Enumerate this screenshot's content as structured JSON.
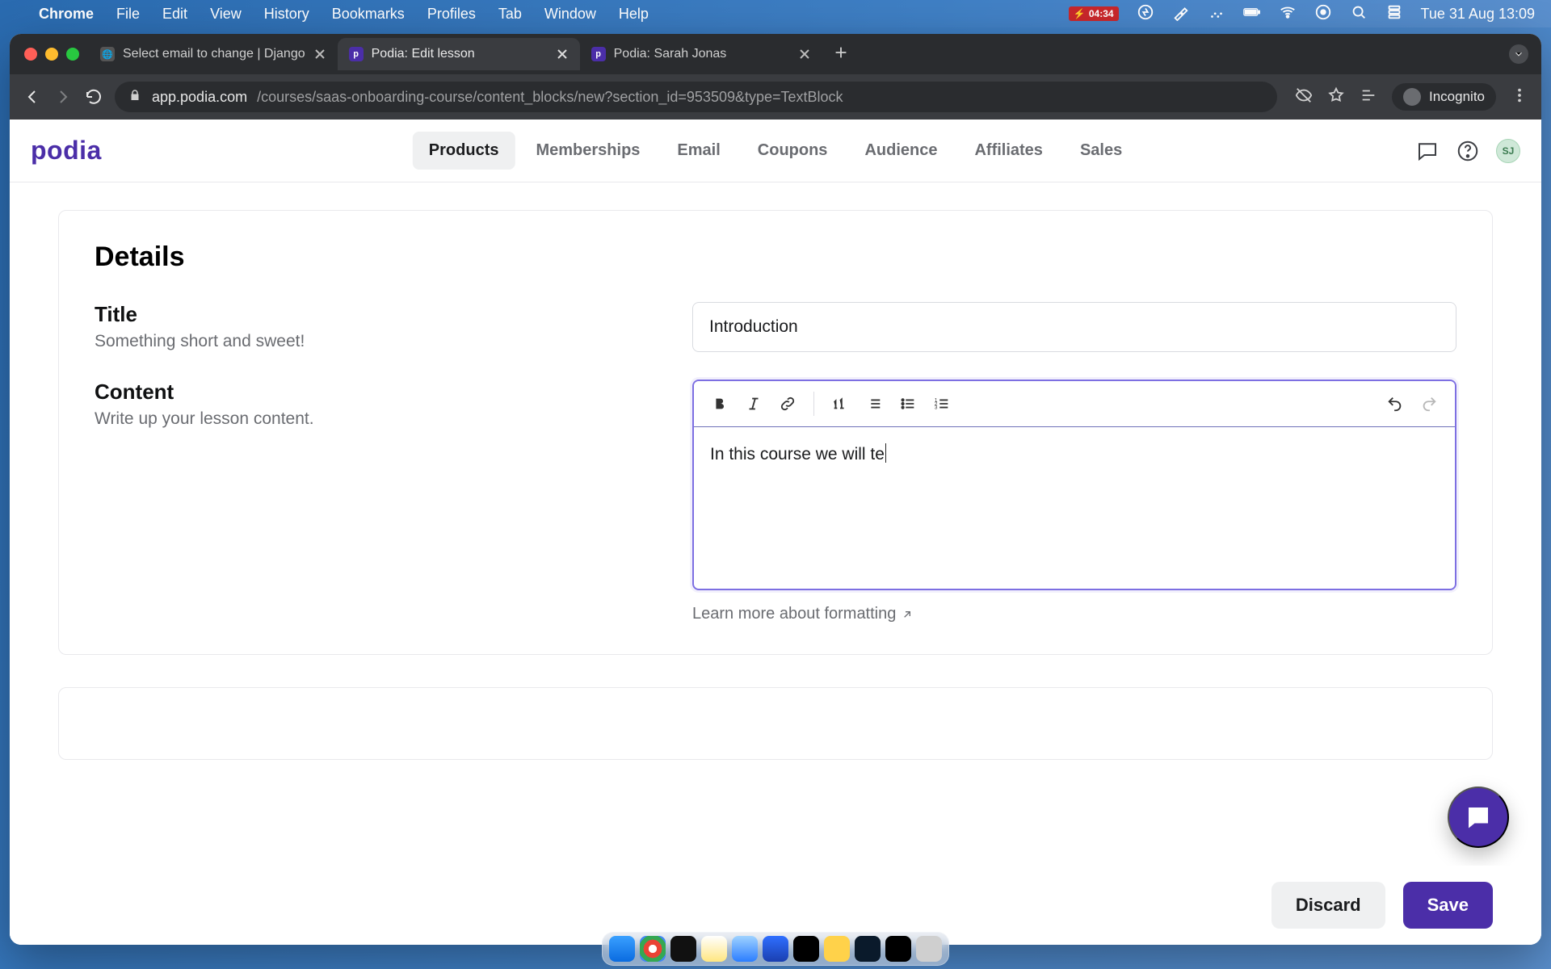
{
  "mac": {
    "menu": [
      "Chrome",
      "File",
      "Edit",
      "View",
      "History",
      "Bookmarks",
      "Profiles",
      "Tab",
      "Window",
      "Help"
    ],
    "battery_time": "04:34",
    "clock": "Tue 31 Aug  13:09"
  },
  "browser": {
    "tabs": [
      {
        "title": "Select email to change | Django",
        "favicon": "globe",
        "active": false
      },
      {
        "title": "Podia: Edit lesson",
        "favicon": "podia",
        "active": true
      },
      {
        "title": "Podia: Sarah Jonas",
        "favicon": "podia",
        "active": false
      }
    ],
    "url_host": "app.podia.com",
    "url_path": "/courses/saas-onboarding-course/content_blocks/new?section_id=953509&type=TextBlock",
    "incognito_label": "Incognito"
  },
  "app": {
    "logo": "podia",
    "nav": [
      "Products",
      "Memberships",
      "Email",
      "Coupons",
      "Audience",
      "Affiliates",
      "Sales"
    ],
    "active_nav": "Products",
    "avatar_initials": "SJ"
  },
  "page": {
    "details_heading": "Details",
    "title_label": "Title",
    "title_help": "Something short and sweet!",
    "title_value": "Introduction",
    "content_label": "Content",
    "content_help": "Write up your lesson content.",
    "content_value": "In this course we will te",
    "formatting_link": "Learn more about formatting"
  },
  "actions": {
    "discard": "Discard",
    "save": "Save"
  }
}
